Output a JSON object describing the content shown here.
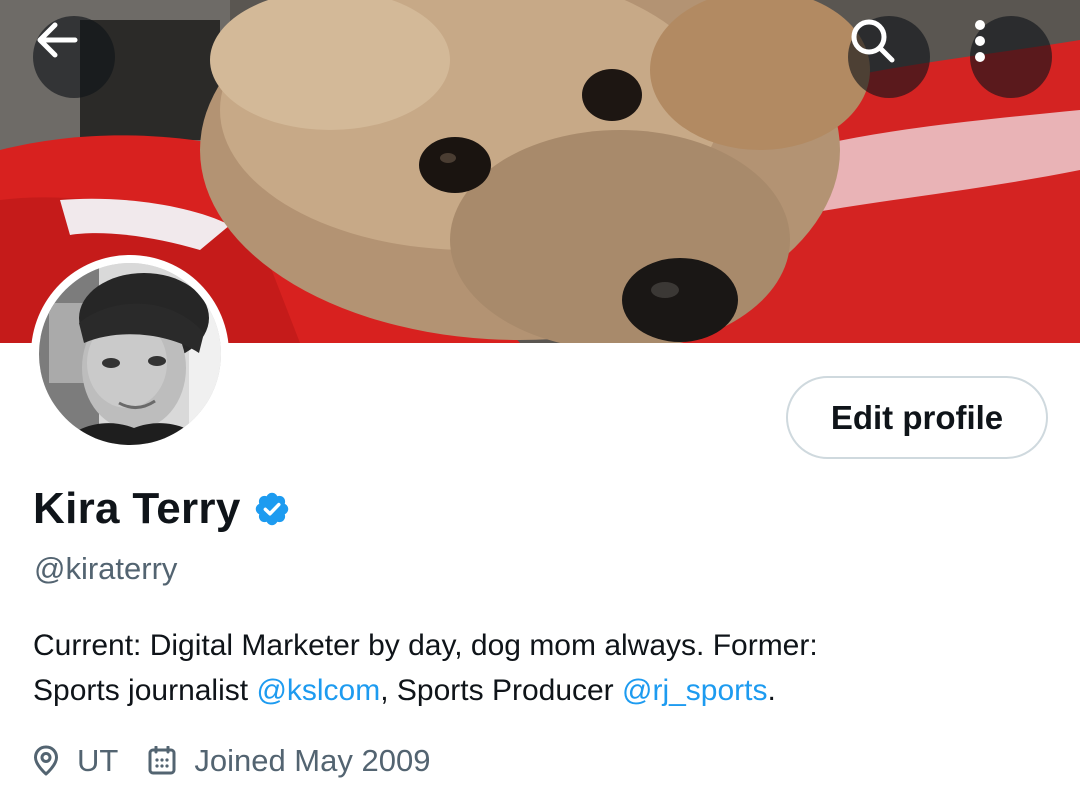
{
  "header": {
    "back_icon": "arrow-left-icon",
    "search_icon": "search-icon",
    "more_icon": "more-vertical-icon"
  },
  "profile": {
    "name": "Kira Terry",
    "verified": true,
    "verified_color": "#1d9bf0",
    "handle": "@kiraterry",
    "edit_profile_label": "Edit profile",
    "bio": {
      "line1": "Current: Digital Marketer by day, dog mom always. Former:",
      "line2_prefix": "Sports journalist ",
      "mention1": "@kslcom",
      "line2_middle": ", Sports Producer ",
      "mention2": "@rj_sports",
      "line2_suffix": "."
    },
    "location": "UT",
    "joined": "Joined May 2009"
  },
  "colors": {
    "text_primary": "#0f1419",
    "text_secondary": "#536471",
    "link": "#1d9bf0",
    "button_border": "#cfd9de"
  }
}
